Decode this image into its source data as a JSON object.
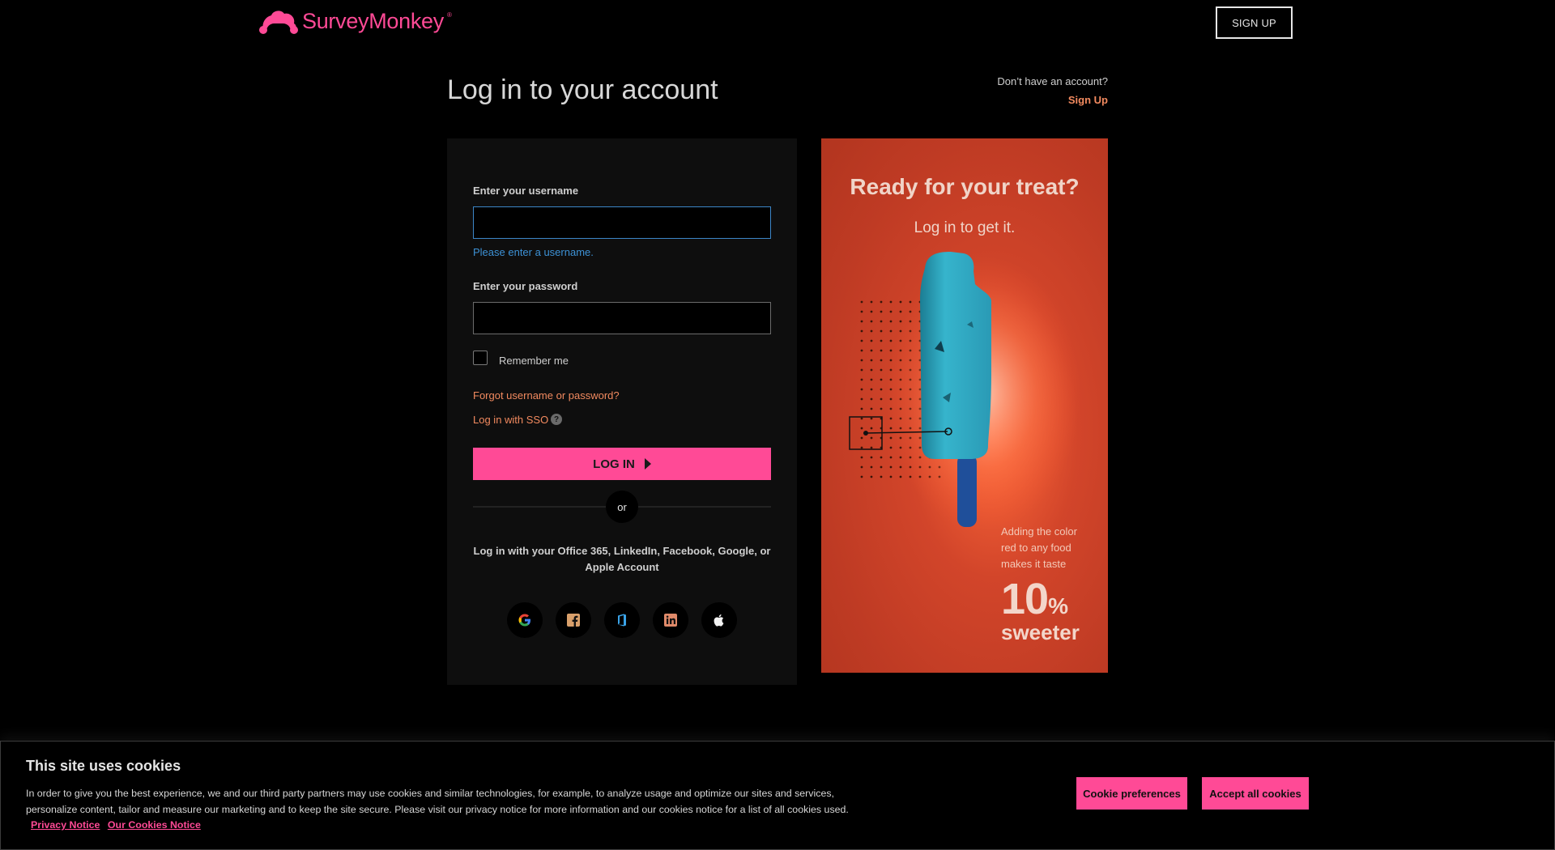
{
  "header": {
    "logo_text": "SurveyMonkey",
    "logo_reg": "®",
    "signup_button": "SIGN UP"
  },
  "page": {
    "title": "Log in to your account",
    "no_account_text": "Don’t have an account?",
    "no_account_link": "Sign Up"
  },
  "form": {
    "username_label": "Enter your username",
    "username_value": "",
    "username_hint": "Please enter a username.",
    "password_label": "Enter your password",
    "password_value": "",
    "remember_label": "Remember me",
    "forgot_link": "Forgot username or password?",
    "sso_link": "Log in with SSO",
    "sso_help": "?",
    "login_button": "LOG IN",
    "or_text": "or",
    "social_text": "Log in with your Office 365, LinkedIn, Facebook, Google, or Apple Account",
    "social_icons": [
      "google-icon",
      "facebook-icon",
      "office365-icon",
      "linkedin-icon",
      "apple-icon"
    ]
  },
  "promo": {
    "title": "Ready for your treat?",
    "subtitle": "Log in to get it.",
    "fact": "Adding the color red to any food makes it taste",
    "percent": "10",
    "percent_symbol": "%",
    "sweeter": "sweeter"
  },
  "cookie": {
    "title": "This site uses cookies",
    "body": "In order to give you the best experience, we and our third party partners may use cookies and similar technologies, for example, to analyze usage and optimize our sites and services, personalize content, tailor and measure our marketing and to keep the site secure. Please visit our privacy notice for more information and our cookies notice for a list of all cookies used.",
    "privacy_link": "Privacy Notice",
    "cookies_link": "Our Cookies Notice",
    "preferences_button": "Cookie preferences",
    "accept_button": "Accept all cookies"
  },
  "colors": {
    "brand_pink": "#ff4a96",
    "link_orange": "#f28a5f",
    "hint_blue": "#3d92d6",
    "promo_red": "#c2402a"
  }
}
